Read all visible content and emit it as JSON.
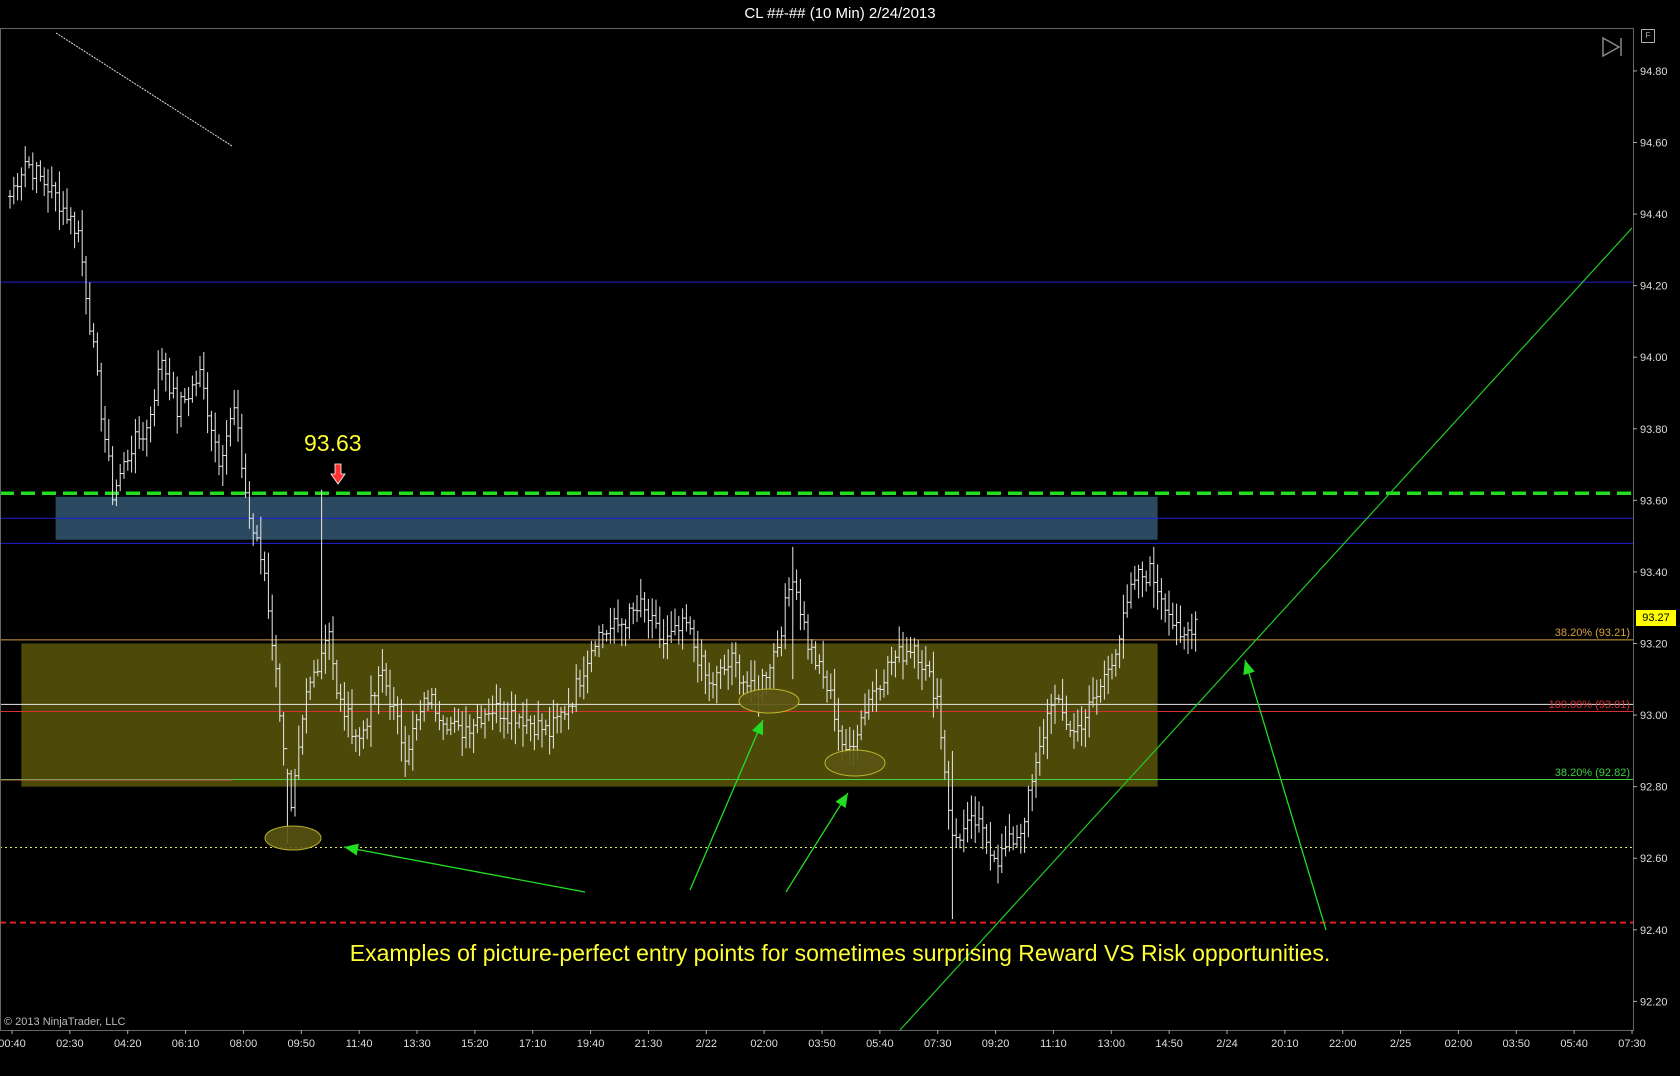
{
  "title": "CL ##-## (10 Min)  2/24/2013",
  "copyright": "© 2013 NinjaTrader, LLC",
  "annotation": "Examples of picture-perfect entry points for sometimes surprising Reward VS Risk opportunities.",
  "price_label": "93.63",
  "current_price": "93.27",
  "flat_button": "F",
  "fib_labels": [
    {
      "text": "38.20% (93.21)",
      "color": "#d8a040"
    },
    {
      "text": "100.00% (93.01)",
      "color": "#d83030"
    },
    {
      "text": "38.20% (92.82)",
      "color": "#40d040"
    }
  ],
  "chart_data": {
    "type": "bar",
    "series_kind": "ohlc",
    "ylim": [
      92.12,
      94.92
    ],
    "y_ticks": [
      "94.80",
      "94.60",
      "94.40",
      "94.20",
      "94.00",
      "93.80",
      "93.60",
      "93.40",
      "93.20",
      "93.00",
      "92.80",
      "92.60",
      "92.40",
      "92.20"
    ],
    "x_ticks": [
      "00:40",
      "02:30",
      "04:20",
      "06:10",
      "08:00",
      "09:50",
      "11:40",
      "13:30",
      "15:20",
      "17:10",
      "19:40",
      "21:30",
      "2/22",
      "02:00",
      "03:50",
      "05:40",
      "07:30",
      "09:20",
      "11:10",
      "13:00",
      "14:50",
      "2/24",
      "20:10",
      "22:00",
      "2/25",
      "02:00",
      "03:50",
      "05:40",
      "07:30"
    ],
    "bar_anchors": [
      {
        "bar": 0,
        "price": 94.45
      },
      {
        "bar": 4,
        "price": 94.55
      },
      {
        "bar": 12,
        "price": 94.45
      },
      {
        "bar": 18,
        "price": 94.35
      },
      {
        "bar": 21,
        "price": 94.1
      },
      {
        "bar": 24,
        "price": 93.85
      },
      {
        "bar": 27,
        "price": 93.62
      },
      {
        "bar": 32,
        "price": 93.75
      },
      {
        "bar": 36,
        "price": 93.8
      },
      {
        "bar": 40,
        "price": 94.0
      },
      {
        "bar": 44,
        "price": 93.85
      },
      {
        "bar": 50,
        "price": 93.95
      },
      {
        "bar": 55,
        "price": 93.72
      },
      {
        "bar": 59,
        "price": 93.85
      },
      {
        "bar": 63,
        "price": 93.55
      },
      {
        "bar": 67,
        "price": 93.4
      },
      {
        "bar": 71,
        "price": 93.02
      },
      {
        "bar": 74,
        "price": 92.72
      },
      {
        "bar": 78,
        "price": 93.05
      },
      {
        "bar": 84,
        "price": 93.25
      },
      {
        "bar": 86,
        "price": 93.05
      },
      {
        "bar": 92,
        "price": 92.93
      },
      {
        "bar": 98,
        "price": 93.12
      },
      {
        "bar": 104,
        "price": 92.9
      },
      {
        "bar": 110,
        "price": 93.05
      },
      {
        "bar": 118,
        "price": 92.95
      },
      {
        "bar": 126,
        "price": 93.02
      },
      {
        "bar": 134,
        "price": 93.0
      },
      {
        "bar": 142,
        "price": 92.95
      },
      {
        "bar": 148,
        "price": 93.05
      },
      {
        "bar": 154,
        "price": 93.22
      },
      {
        "bar": 160,
        "price": 93.25
      },
      {
        "bar": 166,
        "price": 93.3
      },
      {
        "bar": 172,
        "price": 93.2
      },
      {
        "bar": 178,
        "price": 93.25
      },
      {
        "bar": 184,
        "price": 93.08
      },
      {
        "bar": 190,
        "price": 93.15
      },
      {
        "bar": 196,
        "price": 93.05
      },
      {
        "bar": 202,
        "price": 93.2
      },
      {
        "bar": 206,
        "price": 93.4
      },
      {
        "bar": 210,
        "price": 93.2
      },
      {
        "bar": 216,
        "price": 93.05
      },
      {
        "bar": 220,
        "price": 92.88
      },
      {
        "bar": 226,
        "price": 93.05
      },
      {
        "bar": 232,
        "price": 93.15
      },
      {
        "bar": 238,
        "price": 93.2
      },
      {
        "bar": 244,
        "price": 93.05
      },
      {
        "bar": 248,
        "price": 92.65
      },
      {
        "bar": 254,
        "price": 92.7
      },
      {
        "bar": 260,
        "price": 92.6
      },
      {
        "bar": 266,
        "price": 92.68
      },
      {
        "bar": 270,
        "price": 92.85
      },
      {
        "bar": 274,
        "price": 93.05
      },
      {
        "bar": 280,
        "price": 92.95
      },
      {
        "bar": 286,
        "price": 93.05
      },
      {
        "bar": 292,
        "price": 93.22
      },
      {
        "bar": 296,
        "price": 93.38
      },
      {
        "bar": 300,
        "price": 93.4
      },
      {
        "bar": 304,
        "price": 93.32
      },
      {
        "bar": 308,
        "price": 93.2
      },
      {
        "bar": 312,
        "price": 93.27
      }
    ],
    "bar_count": 313,
    "key_points": [
      {
        "bar": 82,
        "high": 93.63,
        "low": 93.1
      },
      {
        "bar": 73,
        "high": 92.85,
        "low": 92.64
      },
      {
        "bar": 248,
        "high": 92.9,
        "low": 92.43
      },
      {
        "bar": 206,
        "high": 93.47,
        "low": 93.1
      },
      {
        "bar": 301,
        "high": 93.47,
        "low": 93.3
      }
    ],
    "horizontal_levels": [
      {
        "price": 94.21,
        "color": "#2020d8",
        "style": "solid"
      },
      {
        "price": 93.62,
        "color": "#22dd22",
        "style": "dashed-bold"
      },
      {
        "price": 93.55,
        "color": "#2020d8",
        "style": "solid"
      },
      {
        "price": 93.48,
        "color": "#2020d8",
        "style": "solid"
      },
      {
        "price": 93.21,
        "color": "#d8a040",
        "style": "solid"
      },
      {
        "price": 93.03,
        "color": "#e8e8e8",
        "style": "solid"
      },
      {
        "price": 93.01,
        "color": "#d83030",
        "style": "solid"
      },
      {
        "price": 92.82,
        "color": "#40d040",
        "style": "solid"
      },
      {
        "price": 92.63,
        "color": "#e8e860",
        "style": "dotted"
      },
      {
        "price": 92.42,
        "color": "#e02020",
        "style": "dashed"
      }
    ],
    "zones": [
      {
        "name": "resistance-zone",
        "from_bar": 12,
        "to_bar": 302,
        "top": 93.61,
        "bottom": 93.49,
        "color": "#2f4f68"
      },
      {
        "name": "support-zone",
        "from_bar": 3,
        "to_bar": 302,
        "top": 93.2,
        "bottom": 92.8,
        "color": "#54500a"
      }
    ],
    "grid": false
  }
}
